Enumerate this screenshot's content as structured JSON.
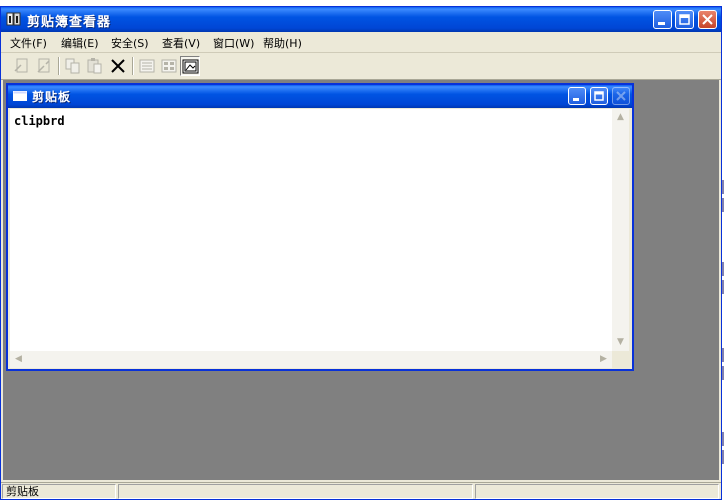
{
  "app": {
    "title": "剪贴簿查看器"
  },
  "menu": {
    "items": [
      {
        "label": "文件(F)"
      },
      {
        "label": "编辑(E)"
      },
      {
        "label": "安全(S)"
      },
      {
        "label": "查看(V)"
      },
      {
        "label": "窗口(W)"
      },
      {
        "label": "帮助(H)"
      }
    ]
  },
  "toolbar": {
    "buttons": [
      {
        "name": "connect-icon",
        "enabled": false
      },
      {
        "name": "disconnect-icon",
        "enabled": false
      },
      {
        "name": "copy-icon",
        "enabled": false
      },
      {
        "name": "paste-icon",
        "enabled": false
      },
      {
        "name": "delete-icon",
        "enabled": true
      },
      {
        "name": "table-of-contents-icon",
        "enabled": false
      },
      {
        "name": "list-view-icon",
        "enabled": false
      },
      {
        "name": "full-page-icon",
        "enabled": true,
        "pressed": true
      }
    ]
  },
  "child_window": {
    "title": "剪贴板",
    "content": "clipbrd"
  },
  "status_bar": {
    "text": "剪贴板"
  },
  "colors": {
    "title_bar": "#0054e3",
    "window_face": "#ece9d8",
    "mdi_background": "#808080",
    "close_button": "#c6452a"
  }
}
